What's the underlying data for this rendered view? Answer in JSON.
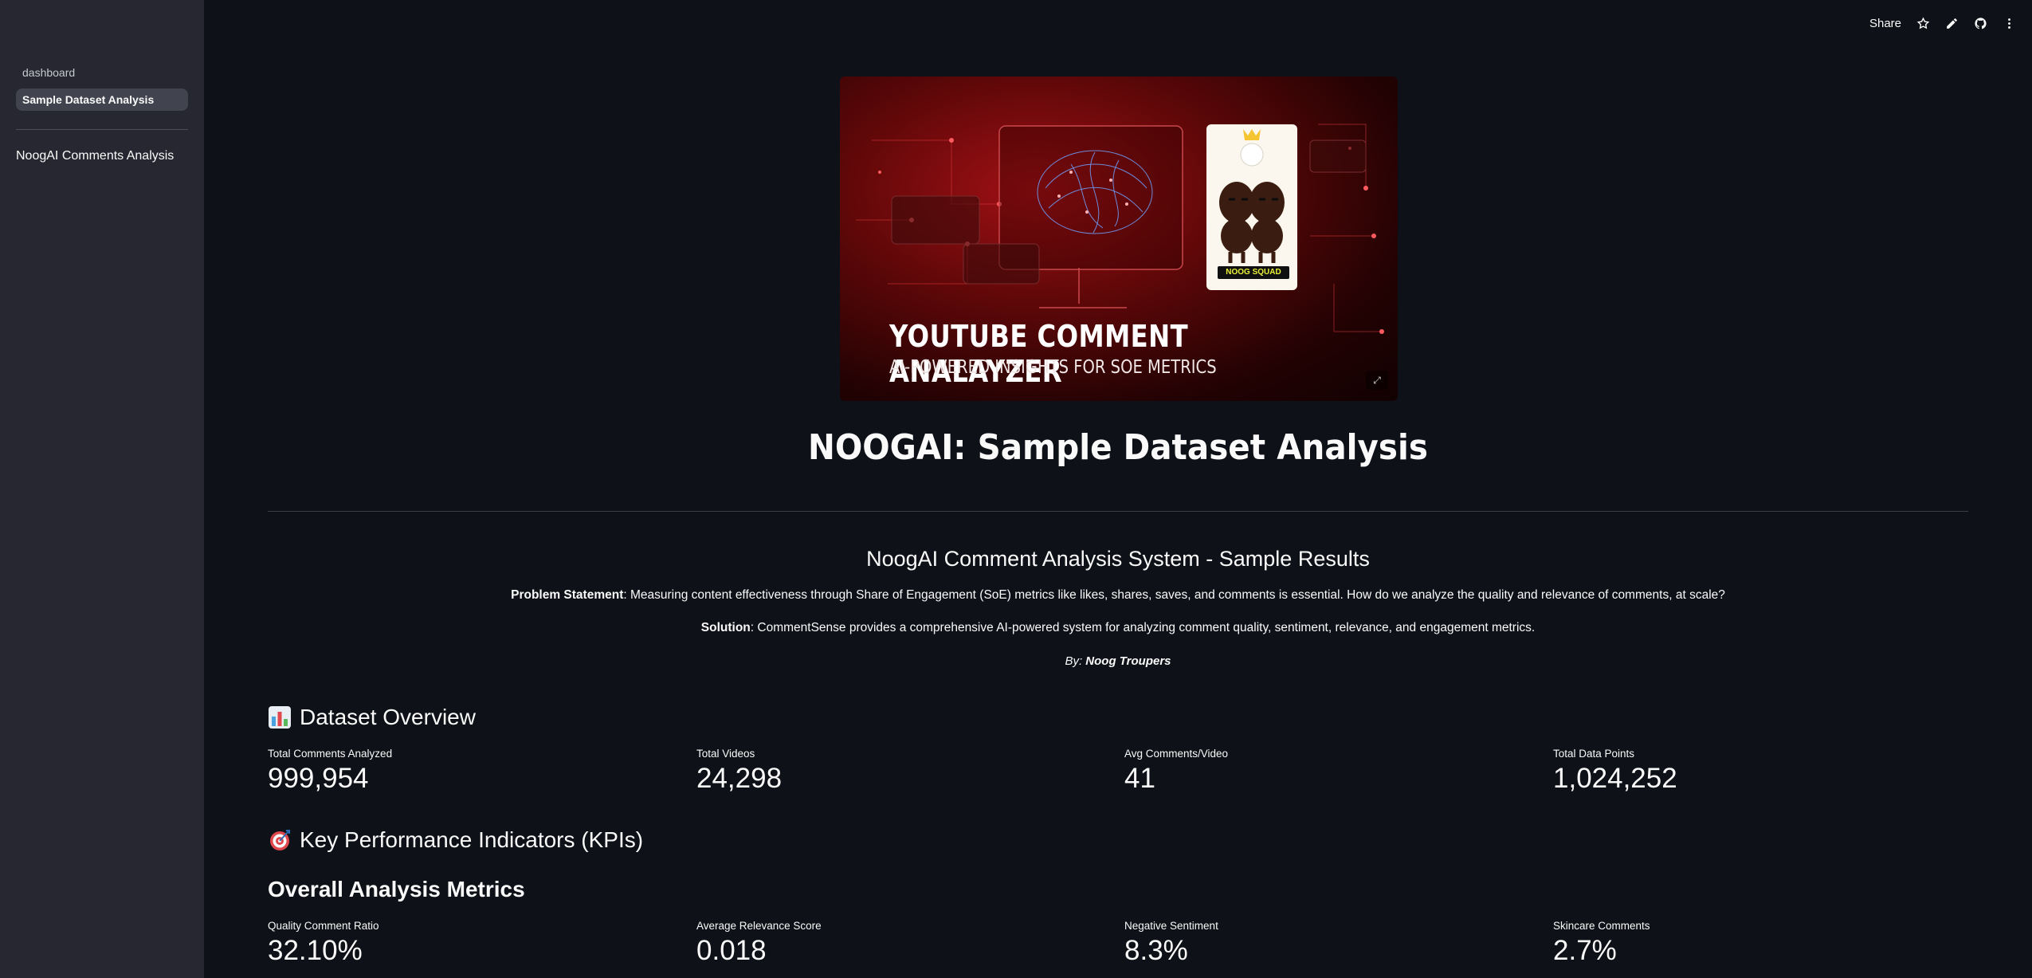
{
  "sidebar": {
    "nav": [
      {
        "label": "dashboard",
        "active": false
      },
      {
        "label": "Sample Dataset Analysis",
        "active": true
      }
    ],
    "link": "NoogAI Comments Analysis"
  },
  "topbar": {
    "share_label": "Share",
    "icons": [
      "star-icon",
      "edit-icon",
      "github-icon",
      "more-vert-icon"
    ]
  },
  "banner": {
    "title": "YOUTUBE COMMENT ANALAYZER",
    "subtitle": "AI-POWERED INSIGHTS FOR SOE METRICS",
    "badge": "NOOG SQUAD"
  },
  "main": {
    "title": "NOOGAI: Sample Dataset Analysis",
    "subtitle": "NoogAI Comment Analysis System - Sample Results",
    "problem_label": "Problem Statement",
    "problem_text": ": Measuring content effectiveness through Share of Engagement (SoE) metrics like likes, shares, saves, and comments is essential. How do we analyze the quality and relevance of comments, at scale?",
    "solution_label": "Solution",
    "solution_text": ": CommentSense provides a comprehensive AI-powered system for analyzing comment quality, sentiment, relevance, and engagement metrics.",
    "by_label": "By: ",
    "by_name": "Noog Troupers"
  },
  "dataset_overview": {
    "heading": "Dataset Overview",
    "metrics": [
      {
        "label": "Total Comments Analyzed",
        "value": "999,954"
      },
      {
        "label": "Total Videos",
        "value": "24,298"
      },
      {
        "label": "Avg Comments/Video",
        "value": "41"
      },
      {
        "label": "Total Data Points",
        "value": "1,024,252"
      }
    ]
  },
  "kpis": {
    "heading": "Key Performance Indicators (KPIs)",
    "subheading": "Overall Analysis Metrics",
    "metrics": [
      {
        "label": "Quality Comment Ratio",
        "value": "32.10%"
      },
      {
        "label": "Average Relevance Score",
        "value": "0.018"
      },
      {
        "label": "Negative Sentiment",
        "value": "8.3%"
      },
      {
        "label": "Skincare Comments",
        "value": "2.7%"
      }
    ]
  },
  "colors": {
    "background": "#0e1117",
    "sidebar": "#262730",
    "active_nav": "#41434e",
    "banner_red": "#a01014"
  }
}
